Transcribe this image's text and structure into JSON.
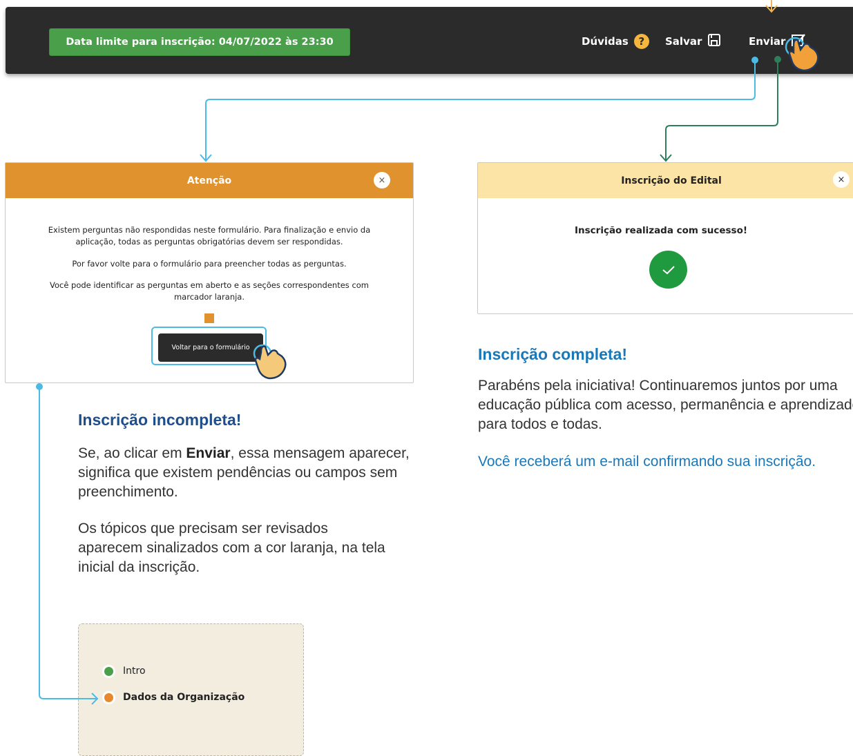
{
  "topbar": {
    "deadline": "Data limite para inscrição: 04/07/2022 às 23:30",
    "doubts_label": "Dúvidas",
    "save_label": "Salvar",
    "send_label": "Enviar"
  },
  "attention_modal": {
    "title": "Atenção",
    "close_symbol": "×",
    "text1": "Existem perguntas não respondidas neste formulário. Para finalização e envio da aplicação, todas as perguntas obrigatórias devem ser respondidas.",
    "text2": "Por favor volte para o formulário para preencher todas as perguntas.",
    "text3": "Você pode identificar as perguntas em aberto e as seções correspondentes com marcador laranja.",
    "button": "Voltar para o formulário"
  },
  "success_modal": {
    "title": "Inscrição do Edital",
    "close_symbol": "×",
    "message": "Inscrição realizada com sucesso!"
  },
  "incomplete": {
    "heading": "Inscrição incompleta!",
    "para1_a": "Se, ao clicar em ",
    "para1_b": "Enviar",
    "para1_c": ", essa mensagem aparecer, significa que existem pendências ou campos sem preenchimento.",
    "para2": "Os tópicos que precisam ser revisados aparecem sinalizados com a cor laranja, na tela inicial da inscrição."
  },
  "complete": {
    "heading": "Inscrição completa!",
    "para1": "Parabéns pela iniciativa! Continuaremos juntos por uma educação pública com acesso, permanência e aprendizado para todos e todas.",
    "para2": "Você receberá um e-mail confirmando sua inscrição."
  },
  "sections": [
    {
      "label": "Intro",
      "status_color": "#4aa04a"
    },
    {
      "label": "Dados da Organização",
      "status_color": "#e8872b"
    }
  ],
  "colors": {
    "orange": "#e0922f",
    "success_header": "#fbe4a6",
    "green": "#1f9a3f",
    "blue_heading_dark": "#1f4e8c",
    "blue_heading": "#1a77b8",
    "connector_blue": "#4bbbe6",
    "connector_green": "#2e7d5b"
  }
}
